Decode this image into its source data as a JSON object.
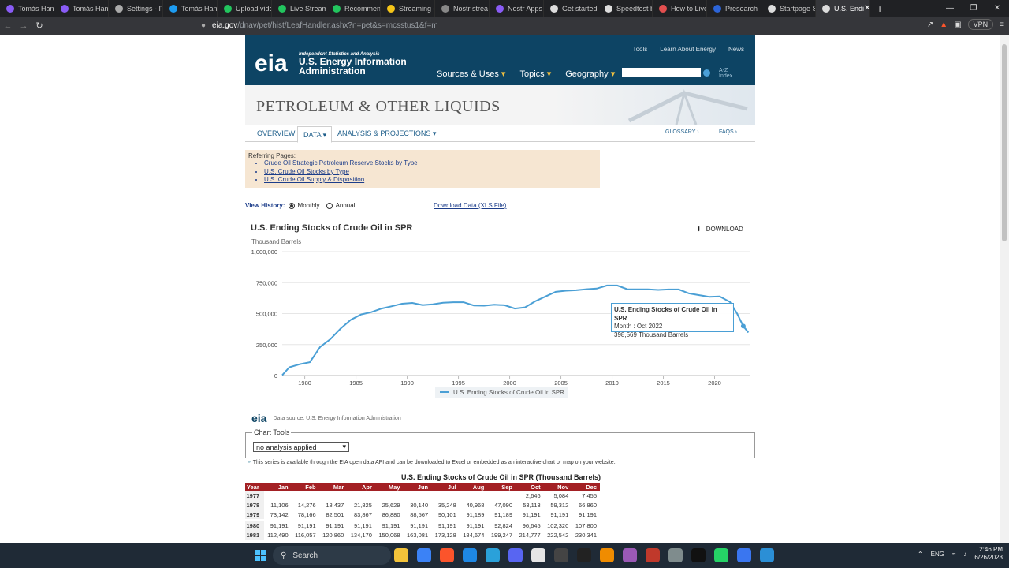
{
  "browser": {
    "tabs": [
      {
        "label": "Tomás Hand",
        "color": "#8a5cf6"
      },
      {
        "label": "Tomás Hand",
        "color": "#8a5cf6"
      },
      {
        "label": "Settings - Pr",
        "color": "#aaaaaa"
      },
      {
        "label": "Tomás Hand",
        "color": "#1d9bf0"
      },
      {
        "label": "Upload vide",
        "color": "#22c55e"
      },
      {
        "label": "Live Streami",
        "color": "#22c55e"
      },
      {
        "label": "Recommend",
        "color": "#22c55e"
      },
      {
        "label": "Streaming o",
        "color": "#f5c518"
      },
      {
        "label": "Nostr strea",
        "color": "#888888"
      },
      {
        "label": "Nostr Apps",
        "color": "#8a5cf6"
      },
      {
        "label": "Get started",
        "color": "#dddddd"
      },
      {
        "label": "Speedtest b",
        "color": "#dddddd"
      },
      {
        "label": "How to Live",
        "color": "#e34f4f"
      },
      {
        "label": "Presearch",
        "color": "#2c64d8"
      },
      {
        "label": "Startpage Se",
        "color": "#dddddd"
      },
      {
        "label": "U.S. Endi",
        "color": "#dddddd"
      }
    ],
    "url_host": "eia.gov",
    "url_path": "/dnav/pet/hist/LeafHandler.ashx?n=pet&s=mcsstus1&f=m",
    "vpn": "VPN"
  },
  "header": {
    "logo": "eia",
    "tagline": "Independent Statistics and Analysis",
    "name_line1": "U.S. Energy Information",
    "name_line2": "Administration",
    "top_links": [
      "Tools",
      "Learn About Energy",
      "News"
    ],
    "main_links": [
      "Sources & Uses",
      "Topics",
      "Geography"
    ],
    "az": "A-Z",
    "index": "Index"
  },
  "banner": {
    "title": "PETROLEUM & OTHER LIQUIDS"
  },
  "subnav": {
    "overview": "OVERVIEW",
    "data": "DATA",
    "analysis": "ANALYSIS & PROJECTIONS",
    "glossary": "GLOSSARY",
    "faqs": "FAQS"
  },
  "referring": {
    "label": "Referring Pages:",
    "links": [
      "Crude Oil Strategic Petroleum Reserve Stocks by Type",
      "U.S. Crude Oil Stocks by Type",
      "U.S. Crude Oil Supply & Disposition"
    ]
  },
  "history": {
    "label": "View History:",
    "monthly": "Monthly",
    "annual": "Annual",
    "download_link": "Download Data (XLS File)"
  },
  "chart_meta": {
    "download": "DOWNLOAD",
    "datasource": "Data source: U.S. Energy Information Administration"
  },
  "tooltip": {
    "title": "U.S. Ending Stocks of Crude Oil in SPR",
    "month": "Month : Oct 2022",
    "value": "398,569 Thousand Barrels"
  },
  "tools": {
    "legend": "Chart Tools",
    "select": "no analysis applied",
    "api_note": "This series is available through the EIA open data API and can be downloaded to Excel or embedded as an interactive chart or map on your website."
  },
  "table": {
    "title": "U.S. Ending Stocks of Crude Oil in SPR (Thousand Barrels)",
    "headers": [
      "Year",
      "Jan",
      "Feb",
      "Mar",
      "Apr",
      "May",
      "Jun",
      "Jul",
      "Aug",
      "Sep",
      "Oct",
      "Nov",
      "Dec"
    ],
    "rows": [
      [
        "1977",
        "",
        "",
        "",
        "",
        "",
        "",
        "",
        "",
        "",
        "2,646",
        "5,084",
        "7,455"
      ],
      [
        "1978",
        "11,106",
        "14,276",
        "18,437",
        "21,825",
        "25,629",
        "30,140",
        "35,248",
        "40,968",
        "47,090",
        "53,113",
        "59,312",
        "66,860"
      ],
      [
        "1979",
        "73,142",
        "78,166",
        "82,501",
        "83,867",
        "86,880",
        "88,567",
        "90,101",
        "91,189",
        "91,189",
        "91,191",
        "91,191",
        "91,191"
      ],
      [
        "1980",
        "91,191",
        "91,191",
        "91,191",
        "91,191",
        "91,191",
        "91,191",
        "91,191",
        "91,191",
        "92,824",
        "96,645",
        "102,320",
        "107,800"
      ],
      [
        "1981",
        "112,490",
        "116,057",
        "120,860",
        "134,170",
        "150,068",
        "163,081",
        "173,128",
        "184,674",
        "199,247",
        "214,777",
        "222,542",
        "230,341"
      ]
    ]
  },
  "taskbar": {
    "search": "Search",
    "lang": "ENG",
    "time": "2:46 PM",
    "date": "6/26/2023"
  },
  "chart_data": {
    "type": "line",
    "title": "U.S. Ending Stocks of Crude Oil in SPR",
    "ylabel": "Thousand Barrels",
    "ylim": [
      0,
      1000000
    ],
    "yticks": [
      "0",
      "250,000",
      "500,000",
      "750,000",
      "1,000,000"
    ],
    "xticks": [
      "1980",
      "1985",
      "1990",
      "1995",
      "2000",
      "2005",
      "2010",
      "2015",
      "2020"
    ],
    "xlim": [
      1977.8,
      2023.5
    ],
    "legend": "bottom",
    "grid": true,
    "series": [
      {
        "name": "U.S. Ending Stocks of Crude Oil in SPR",
        "color": "#4a9fd5",
        "x": [
          1977.8,
          1978.5,
          1979.5,
          1980.5,
          1981.5,
          1982.5,
          1983.5,
          1984.5,
          1985.5,
          1986.5,
          1987.5,
          1988.5,
          1989.5,
          1990.5,
          1991.5,
          1992.5,
          1993.5,
          1994.5,
          1995.5,
          1996.5,
          1997.5,
          1998.5,
          1999.5,
          2000.5,
          2001.5,
          2002.5,
          2003.5,
          2004.5,
          2005.5,
          2006.5,
          2007.5,
          2008.5,
          2009.5,
          2010.5,
          2011.5,
          2012.5,
          2013.5,
          2014.5,
          2015.5,
          2016.5,
          2017.5,
          2018.5,
          2019.5,
          2020.5,
          2021.5,
          2022.2,
          2022.8,
          2023.3
        ],
        "y": [
          2646,
          66860,
          91191,
          107800,
          230341,
          293800,
          379100,
          450500,
          493300,
          511600,
          540600,
          559500,
          579900,
          585700,
          568500,
          574700,
          587100,
          591700,
          591600,
          565800,
          563400,
          571400,
          567200,
          540700,
          550200,
          599100,
          638400,
          675600,
          684500,
          688600,
          696900,
          701800,
          726600,
          726500,
          696000,
          695300,
          696000,
          691000,
          695100,
          695100,
          662800,
          649100,
          634900,
          638100,
          593700,
          500000,
          398569,
          347000
        ]
      }
    ]
  }
}
